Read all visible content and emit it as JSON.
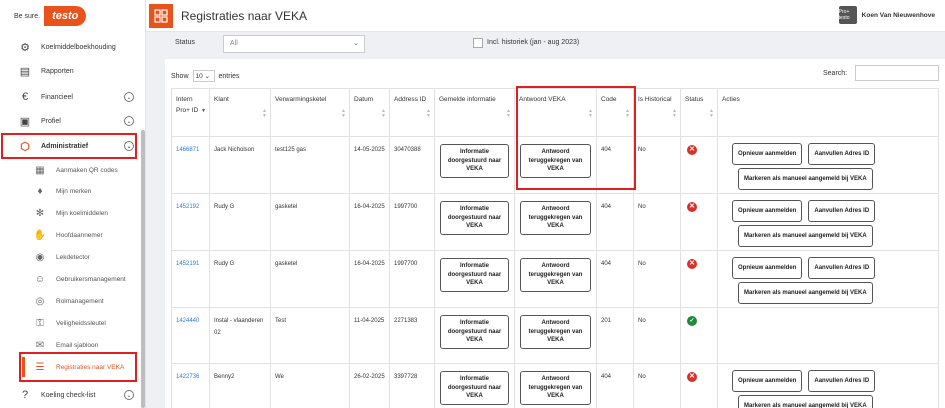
{
  "brand": {
    "tagline": "Be sure.",
    "logo_text": "testo",
    "accent": "#e8531c"
  },
  "header": {
    "title": "Registraties naar VEKA",
    "user_name": "Koen Van Nieuwenhove",
    "user_badge": "Pro+ testo"
  },
  "sidebar": {
    "items": [
      {
        "label": "Koelmiddelboekhouding",
        "icon": "gear-icon"
      },
      {
        "label": "Rapporten",
        "icon": "book-icon"
      },
      {
        "label": "Financieel",
        "icon": "euro-icon"
      },
      {
        "label": "Profiel",
        "icon": "id-card-icon"
      },
      {
        "label": "Administratief",
        "icon": "hexagon-icon"
      }
    ],
    "subitems": [
      {
        "label": "Aanmaken QR codes",
        "icon": "qr-code-icon"
      },
      {
        "label": "Mijn merken",
        "icon": "flame-icon"
      },
      {
        "label": "Mijn koelmiddelen",
        "icon": "snowflake-icon"
      },
      {
        "label": "Hoofdaannemer",
        "icon": "handshake-icon"
      },
      {
        "label": "Lekdetector",
        "icon": "detector-icon"
      },
      {
        "label": "Gebruikersmanagement",
        "icon": "user-icon"
      },
      {
        "label": "Rolmanagement",
        "icon": "eye-icon"
      },
      {
        "label": "Veiligheidssleutel",
        "icon": "key-icon"
      },
      {
        "label": "Email sjabloon",
        "icon": "mail-icon"
      },
      {
        "label": "Registraties naar VEKA",
        "icon": "list-icon"
      }
    ],
    "bottom": {
      "label": "Koeling check-list",
      "icon": "help-icon"
    }
  },
  "filters": {
    "status_label": "Status",
    "status_value": "All",
    "historic_label": "Incl. historiek (jan - aug 2023)"
  },
  "table_controls": {
    "show_label": "Show",
    "entries_value": "10",
    "entries_label": "entries",
    "search_label": "Search:"
  },
  "columns": [
    "Intern Pro+ ID",
    "Klant",
    "Verwarmingsketel",
    "Datum",
    "Address ID",
    "Gemelde informatie",
    "Antwoord VEKA",
    "Code",
    "Is Historical",
    "Status",
    "Acties"
  ],
  "buttons": {
    "informed": "Informatie doorgestuurd naar VEKA",
    "answer": "Antwoord teruggekregen van VEKA",
    "re_register": "Opnieuw aanmelden",
    "complete_address": "Aanvullen Adres ID",
    "mark_manual": "Markeren als manueel aangemeld bij VEKA"
  },
  "rows": [
    {
      "id": "1466871",
      "klant": "Jack Nicholson",
      "ketel": "test125 gas",
      "datum": "14-05-2025",
      "address": "30470388",
      "code": "404",
      "historical": "No",
      "status": "error"
    },
    {
      "id": "1452192",
      "klant": "Rudy G",
      "ketel": "gasketel",
      "datum": "16-04-2025",
      "address": "1997700",
      "code": "404",
      "historical": "No",
      "status": "error"
    },
    {
      "id": "1452191",
      "klant": "Rudy G",
      "ketel": "gasketel",
      "datum": "16-04-2025",
      "address": "1997700",
      "code": "404",
      "historical": "No",
      "status": "error"
    },
    {
      "id": "1424440",
      "klant": "Instal - vlaanderen 02",
      "ketel": "Test",
      "datum": "11-04-2025",
      "address": "2271383",
      "code": "201",
      "historical": "No",
      "status": "ok"
    },
    {
      "id": "1422736",
      "klant": "Benny2",
      "ketel": "We",
      "datum": "26-02-2025",
      "address": "3397728",
      "code": "404",
      "historical": "No",
      "status": "error"
    }
  ]
}
